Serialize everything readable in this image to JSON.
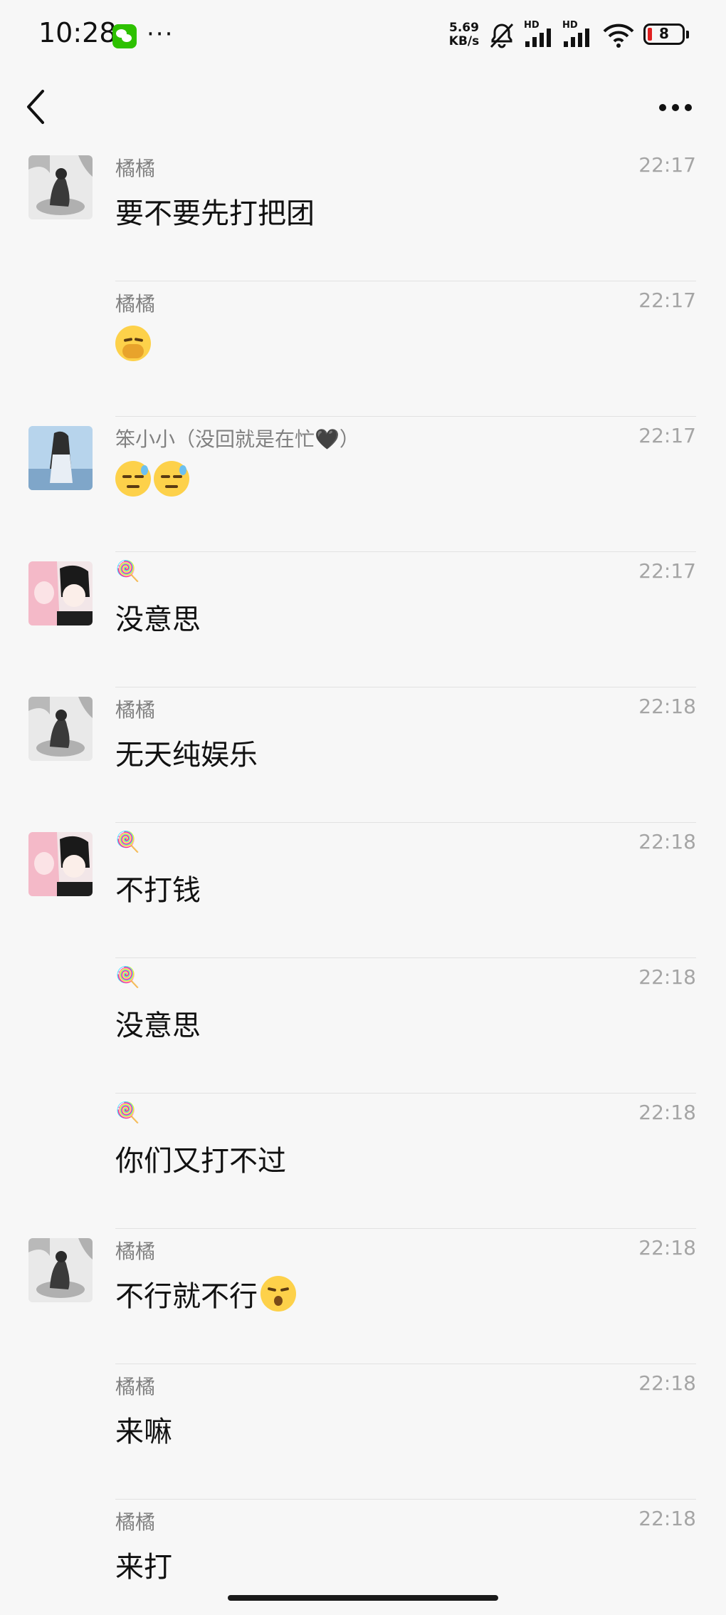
{
  "status_bar": {
    "time": "10:28",
    "more": "···",
    "net_speed_value": "5.69",
    "net_speed_unit": "KB/s",
    "signal_1_label": "HD",
    "signal_2_label": "HD",
    "battery": "8"
  },
  "header": {
    "back_icon": "chevron-left-icon",
    "more_icon": "more-dots-icon"
  },
  "messages": [
    {
      "sender": "橘橘",
      "time": "22:17",
      "text": "要不要先打把团",
      "avatar": "juju",
      "emoji": null
    },
    {
      "sender": "橘橘",
      "time": "22:17",
      "text": "",
      "avatar": null,
      "emoji": "hand-over-mouth-face"
    },
    {
      "sender": "笨小小（没回就是在忙🖤）",
      "time": "22:17",
      "text": "",
      "avatar": "ben",
      "emoji": "sweat-smile-face-x2"
    },
    {
      "sender": "🍭",
      "time": "22:17",
      "text": "没意思",
      "avatar": "candy",
      "emoji": null
    },
    {
      "sender": "橘橘",
      "time": "22:18",
      "text": "无天纯娱乐",
      "avatar": "juju",
      "emoji": null
    },
    {
      "sender": "🍭",
      "time": "22:18",
      "text": "不打钱",
      "avatar": "candy",
      "emoji": null
    },
    {
      "sender": "🍭",
      "time": "22:18",
      "text": "没意思",
      "avatar": null,
      "emoji": null
    },
    {
      "sender": "🍭",
      "time": "22:18",
      "text": "你们又打不过",
      "avatar": null,
      "emoji": null
    },
    {
      "sender": "橘橘",
      "time": "22:18",
      "text": "不行就不行",
      "avatar": "juju",
      "emoji": "kissing-face"
    },
    {
      "sender": "橘橘",
      "time": "22:18",
      "text": "来嘛",
      "avatar": null,
      "emoji": null
    },
    {
      "sender": "橘橘",
      "time": "22:18",
      "text": "来打",
      "avatar": null,
      "emoji": null
    }
  ],
  "colors": {
    "background": "#f7f7f7",
    "sender": "#808080",
    "timestamp": "#a5a5a5",
    "divider": "#e2e2e2"
  }
}
